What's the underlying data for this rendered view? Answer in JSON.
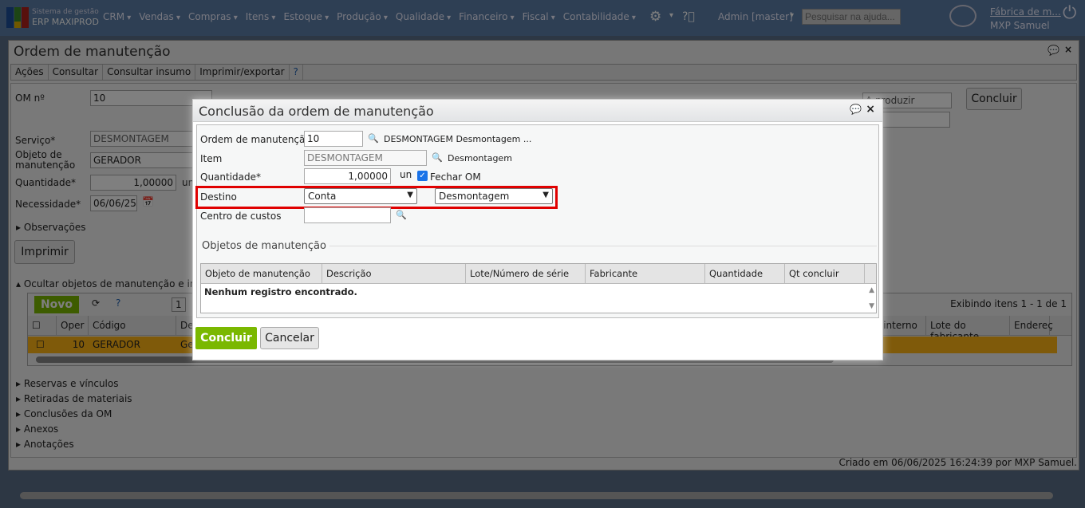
{
  "topbar": {
    "brand_line1": "Sistema de gestão",
    "brand_line2": "ERP MAXIPROD",
    "menu": [
      "CRM",
      "Vendas",
      "Compras",
      "Itens",
      "Estoque",
      "Produção",
      "Qualidade",
      "Financeiro",
      "Fiscal",
      "Contabilidade"
    ],
    "admin": "Admin [master]",
    "help_search_placeholder": "Pesquisar na ajuda...",
    "company": "Fábrica de m...",
    "user": "MXP Samuel"
  },
  "window": {
    "title": "Ordem de manutenção",
    "toolbar": [
      "Ações",
      "Consultar",
      "Consultar insumo",
      "Imprimir/exportar"
    ],
    "fields": {
      "om_label": "OM nº",
      "om_value": "10",
      "servico_label": "Serviço*",
      "servico_value": "DESMONTAGEM",
      "objeto_label": "Objeto de manutenção",
      "objeto_value": "GERADOR",
      "quantidade_label": "Quantidade*",
      "quantidade_value": "1,00000",
      "unit": "un",
      "necessidade_label": "Necessidade*",
      "necessidade_value": "06/06/25",
      "status_value": "A produzir",
      "concluir": "Concluir"
    },
    "observacoes": "Observações",
    "imprimir": "Imprimir",
    "ocultar": "Ocultar objetos de manutenção e insumos",
    "grid": {
      "novo": "Novo",
      "page": "1",
      "showing": "Exibindo itens 1 - 1 de 1",
      "headers": [
        "Oper",
        "Código",
        "De",
        "e interno",
        "Lote do fabricante",
        "Endereç"
      ],
      "row": {
        "oper": "10",
        "codigo": "GERADOR",
        "desc": "Ge"
      }
    },
    "sections": [
      "Reservas e vínculos",
      "Retiradas de materiais",
      "Conclusões da OM",
      "Anexos",
      "Anotações"
    ],
    "footer": "Criado em 06/06/2025 16:24:39 por MXP Samuel."
  },
  "modal": {
    "title": "Conclusão da ordem de manutenção",
    "ordem_label": "Ordem de manutenção",
    "ordem_value": "10",
    "ordem_desc": "DESMONTAGEM Desmontagem ...",
    "item_label": "Item",
    "item_value": "DESMONTAGEM",
    "item_desc": "Desmontagem",
    "quantidade_label": "Quantidade*",
    "quantidade_value": "1,00000",
    "unit": "un",
    "fechar_om": "Fechar OM",
    "destino_label": "Destino",
    "destino_value": "Conta",
    "destino_conta": "Desmontagem",
    "centro_label": "Centro de custos",
    "centro_value": "",
    "objetos_legend": "Objetos de manutenção",
    "headers": [
      "Objeto de manutenção",
      "Descrição",
      "Lote/Número de série",
      "Fabricante",
      "Quantidade",
      "Qt concluir"
    ],
    "empty": "Nenhum registro encontrado.",
    "concluir": "Concluir",
    "cancelar": "Cancelar"
  },
  "colors": {
    "highlight": "#e00000",
    "primary": "#7ab800",
    "row": "#ffb414"
  }
}
